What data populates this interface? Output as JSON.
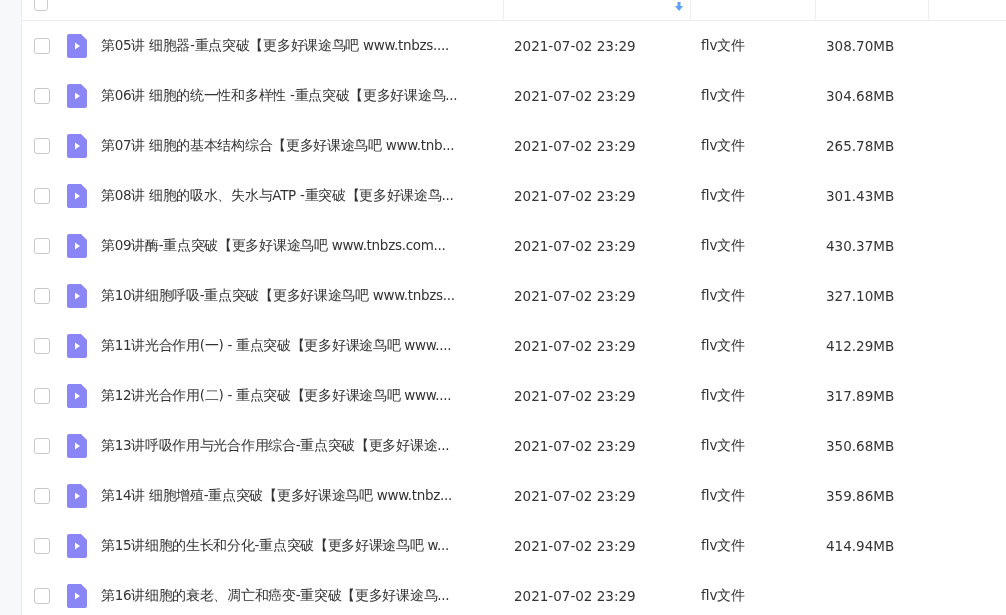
{
  "table": {
    "all_checked": false,
    "columns": [
      {
        "sorted": false
      },
      {
        "sorted": true
      },
      {
        "sorted": false
      },
      {
        "sorted": false
      }
    ],
    "rows": [
      {
        "name": "第05讲 细胞器-重点突破【更多好课途鸟吧 www.tnbzs....",
        "modified": "2021-07-02 23:29",
        "type": "flv文件",
        "size": "308.70MB",
        "checked": false
      },
      {
        "name": "第06讲 细胞的统一性和多样性 -重点突破【更多好课途鸟...",
        "modified": "2021-07-02 23:29",
        "type": "flv文件",
        "size": "304.68MB",
        "checked": false
      },
      {
        "name": "第07讲 细胞的基本结构综合【更多好课途鸟吧 www.tnb...",
        "modified": "2021-07-02 23:29",
        "type": "flv文件",
        "size": "265.78MB",
        "checked": false
      },
      {
        "name": "第08讲 细胞的吸水、失水与ATP -重突破【更多好课途鸟...",
        "modified": "2021-07-02 23:29",
        "type": "flv文件",
        "size": "301.43MB",
        "checked": false
      },
      {
        "name": "第09讲酶-重点突破【更多好课途鸟吧 www.tnbzs.com...",
        "modified": "2021-07-02 23:29",
        "type": "flv文件",
        "size": "430.37MB",
        "checked": false
      },
      {
        "name": "第10讲细胞呼吸-重点突破【更多好课途鸟吧 www.tnbzs...",
        "modified": "2021-07-02 23:29",
        "type": "flv文件",
        "size": "327.10MB",
        "checked": false
      },
      {
        "name": "第11讲光合作用(一) - 重点突破【更多好课途鸟吧 www....",
        "modified": "2021-07-02 23:29",
        "type": "flv文件",
        "size": "412.29MB",
        "checked": false
      },
      {
        "name": "第12讲光合作用(二) - 重点突破【更多好课途鸟吧 www....",
        "modified": "2021-07-02 23:29",
        "type": "flv文件",
        "size": "317.89MB",
        "checked": false
      },
      {
        "name": "第13讲呼吸作用与光合作用综合-重点突破【更多好课途...",
        "modified": "2021-07-02 23:29",
        "type": "flv文件",
        "size": "350.68MB",
        "checked": false
      },
      {
        "name": "第14讲 细胞增殖-重点突破【更多好课途鸟吧 www.tnbz...",
        "modified": "2021-07-02 23:29",
        "type": "flv文件",
        "size": "359.86MB",
        "checked": false
      },
      {
        "name": "第15讲细胞的生长和分化-重点突破【更多好课途鸟吧 w...",
        "modified": "2021-07-02 23:29",
        "type": "flv文件",
        "size": "414.94MB",
        "checked": false
      },
      {
        "name": "第16讲细胞的衰老、凋亡和癌变-重突破【更多好课途鸟...",
        "modified": "2021-07-02 23:29",
        "type": "flv文件",
        "checked": false
      }
    ]
  }
}
